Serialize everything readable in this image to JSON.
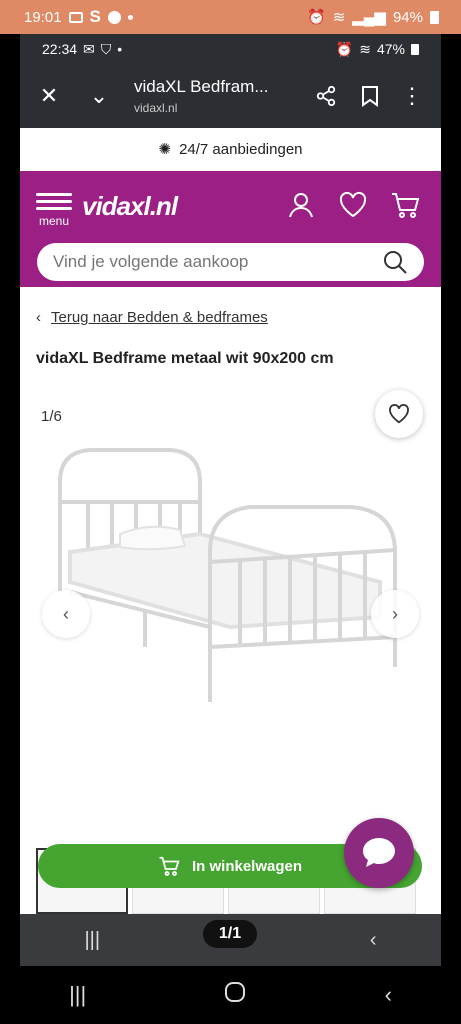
{
  "outer_status": {
    "time": "19:01",
    "battery": "94%"
  },
  "inner_status": {
    "time": "22:34",
    "battery": "47%"
  },
  "browser": {
    "title": "vidaXL Bedfram...",
    "url": "vidaxl.nl"
  },
  "promo": {
    "text": "24/7 aanbiedingen"
  },
  "header": {
    "menu_label": "menu",
    "logo_text": "vidaxl.nl",
    "brand_color": "#9b1f84"
  },
  "search": {
    "placeholder": "Vind je volgende aankoop"
  },
  "breadcrumb": {
    "back_label": "Terug naar Bedden & bedframes"
  },
  "product": {
    "title": "vidaXL Bedframe metaal wit 90x200 cm",
    "image_counter": "1/6"
  },
  "cart": {
    "label": "In winkelwagen",
    "color": "#46a531"
  },
  "pager": {
    "label": "1/1"
  }
}
